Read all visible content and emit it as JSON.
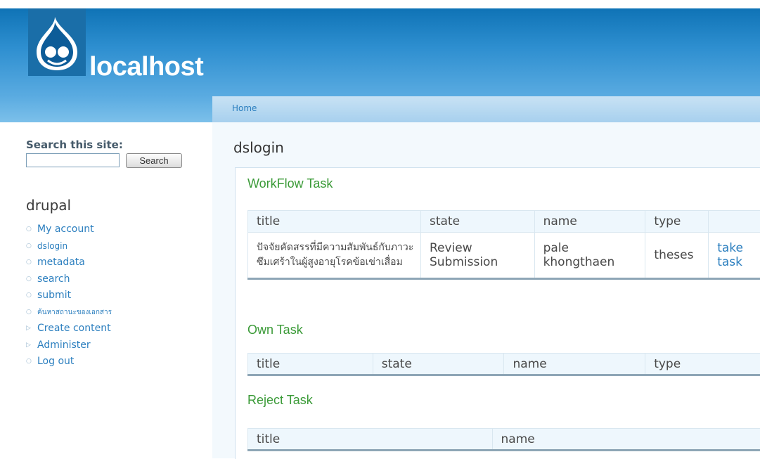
{
  "header": {
    "site_name": "localhost"
  },
  "sidebar": {
    "search_label": "Search this site:",
    "search_value": "",
    "search_button": "Search",
    "block_title": "drupal",
    "menu": [
      {
        "label": "My account"
      },
      {
        "label": "dslogin"
      },
      {
        "label": "metadata"
      },
      {
        "label": "search"
      },
      {
        "label": "submit"
      },
      {
        "label": "ค้นหาสถานะของเอกสาร"
      },
      {
        "label": "Create content"
      },
      {
        "label": "Administer"
      },
      {
        "label": "Log out"
      }
    ]
  },
  "breadcrumb": {
    "home": "Home"
  },
  "page_title": "dslogin",
  "workflow": {
    "title": "WorkFlow Task",
    "headers": [
      "title",
      "state",
      "name",
      "type",
      ""
    ],
    "rows": [
      {
        "title": "ปัจจัยคัดสรรที่มีความสัมพันธ์กับภาวะซึมเศร้าในผู้สูงอายุโรคข้อเข่าเสื่อม",
        "state": "Review Submission",
        "name": "pale khongthaen",
        "type": "theses",
        "action": "take task"
      }
    ]
  },
  "own": {
    "title": "Own Task",
    "headers": [
      "title",
      "state",
      "name",
      "type"
    ]
  },
  "reject": {
    "title": "Reject Task",
    "headers": [
      "title",
      "name"
    ]
  },
  "colors": {
    "header_blue": "#0f73b6",
    "link": "#2c7fbf",
    "section_green": "#3a9a37"
  }
}
